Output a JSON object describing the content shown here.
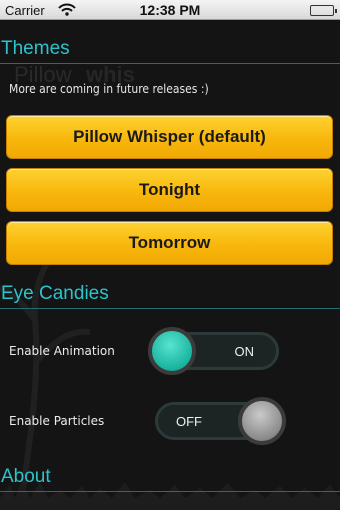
{
  "status_bar": {
    "carrier": "Carrier",
    "time": "12:38 PM"
  },
  "themes": {
    "title": "Themes",
    "subtitle": "More are coming in future releases :)",
    "buttons": [
      "Pillow Whisper (default)",
      "Tonight",
      "Tomorrow"
    ]
  },
  "eye_candies": {
    "title": "Eye Candies",
    "animation": {
      "label": "Enable Animation",
      "state": "ON"
    },
    "particles": {
      "label": "Enable Particles",
      "state": "OFF"
    }
  },
  "about": {
    "title": "About"
  },
  "colors": {
    "accent": "#2bc3cc",
    "button_yellow": "#f8b70c",
    "toggle_on_knob": "#19b49f",
    "battery": "#35c135"
  }
}
